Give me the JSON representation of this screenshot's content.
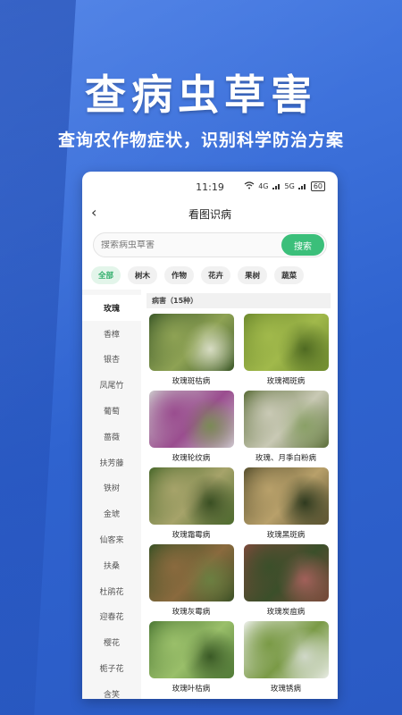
{
  "promo": {
    "title": "查病虫草害",
    "subtitle": "查询农作物症状，识别科学防治方案"
  },
  "status_bar": {
    "time": "11:19",
    "signal1": "4G",
    "signal2": "5G",
    "battery": "60"
  },
  "nav": {
    "title": "看图识病",
    "back_icon": "chevron-left-icon"
  },
  "search": {
    "placeholder": "搜索病虫草害",
    "button_label": "搜索"
  },
  "chips": [
    {
      "label": "全部",
      "active": true
    },
    {
      "label": "树木",
      "active": false
    },
    {
      "label": "作物",
      "active": false
    },
    {
      "label": "花卉",
      "active": false
    },
    {
      "label": "果树",
      "active": false
    },
    {
      "label": "蔬菜",
      "active": false
    }
  ],
  "sidebar": {
    "items": [
      "玫瑰",
      "香樟",
      "银杏",
      "凤尾竹",
      "葡萄",
      "蔷薇",
      "扶芳藤",
      "铁树",
      "金琥",
      "仙客来",
      "扶桑",
      "杜鹃花",
      "迎春花",
      "樱花",
      "栀子花",
      "含笑"
    ],
    "active_index": 0
  },
  "section": {
    "header": "病害（15种）"
  },
  "cards": [
    {
      "label": "玫瑰斑枯病",
      "colors": [
        "#3e5a2a",
        "#8ea254",
        "#d7dcc3"
      ]
    },
    {
      "label": "玫瑰褐斑病",
      "colors": [
        "#6f8b2f",
        "#a1b94b",
        "#4f6a22"
      ]
    },
    {
      "label": "玫瑰轮纹病",
      "colors": [
        "#c9c3c8",
        "#9a4d8f",
        "#7b8a56"
      ]
    },
    {
      "label": "玫瑰、月季白粉病",
      "colors": [
        "#5d6f3b",
        "#c9c9b5",
        "#8aa067"
      ]
    },
    {
      "label": "玫瑰霜霉病",
      "colors": [
        "#4c6a2d",
        "#a6a36a",
        "#3a4f23"
      ]
    },
    {
      "label": "玫瑰黑斑病",
      "colors": [
        "#5a5230",
        "#b8a06a",
        "#2f3a1f"
      ]
    },
    {
      "label": "玫瑰灰霉病",
      "colors": [
        "#3c5226",
        "#8a6a3e",
        "#6b7f41"
      ]
    },
    {
      "label": "玫瑰炭疽病",
      "colors": [
        "#7a4a3a",
        "#3b4f2a",
        "#a2605a"
      ]
    },
    {
      "label": "玫瑰叶枯病",
      "colors": [
        "#4f7a36",
        "#9abf6a",
        "#3a5a26"
      ]
    },
    {
      "label": "玫瑰锈病",
      "colors": [
        "#e8ece4",
        "#7a9a46",
        "#d0d8c8"
      ]
    }
  ]
}
